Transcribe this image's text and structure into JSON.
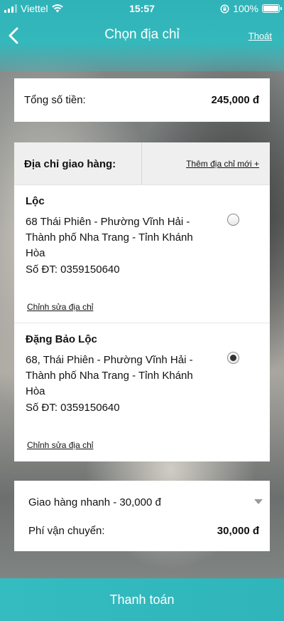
{
  "status_bar": {
    "carrier": "Viettel",
    "time": "15:57",
    "battery": "100%"
  },
  "nav": {
    "title": "Chọn địa chỉ",
    "exit_label": "Thoát"
  },
  "total": {
    "label": "Tổng số tiền:",
    "value": "245,000 đ"
  },
  "address_section": {
    "title": "Địa chỉ giao hàng:",
    "add_new_label": "Thêm địa chỉ mới +",
    "items": [
      {
        "name": "Lộc",
        "address": "68 Thái Phiên - Phường Vĩnh Hải - Thành phố Nha Trang - Tỉnh Khánh Hòa",
        "phone": "Số ĐT: 0359150640",
        "edit_label": "Chỉnh sửa địa chỉ",
        "selected": false
      },
      {
        "name": "Đặng Bảo Lộc",
        "address": "68, Thái Phiên - Phường Vĩnh Hải - Thành phố Nha Trang - Tỉnh Khánh Hòa",
        "phone": "Số ĐT: 0359150640",
        "edit_label": "Chỉnh sửa địa chỉ",
        "selected": true
      }
    ]
  },
  "shipping": {
    "selected_option": "Giao hàng nhanh - 30,000 đ",
    "fee_label": "Phí vận chuyển:",
    "fee_value": "30,000 đ"
  },
  "pay_button_label": "Thanh toán",
  "colors": {
    "accent": "#34b8bc",
    "card": "#ffffff"
  }
}
